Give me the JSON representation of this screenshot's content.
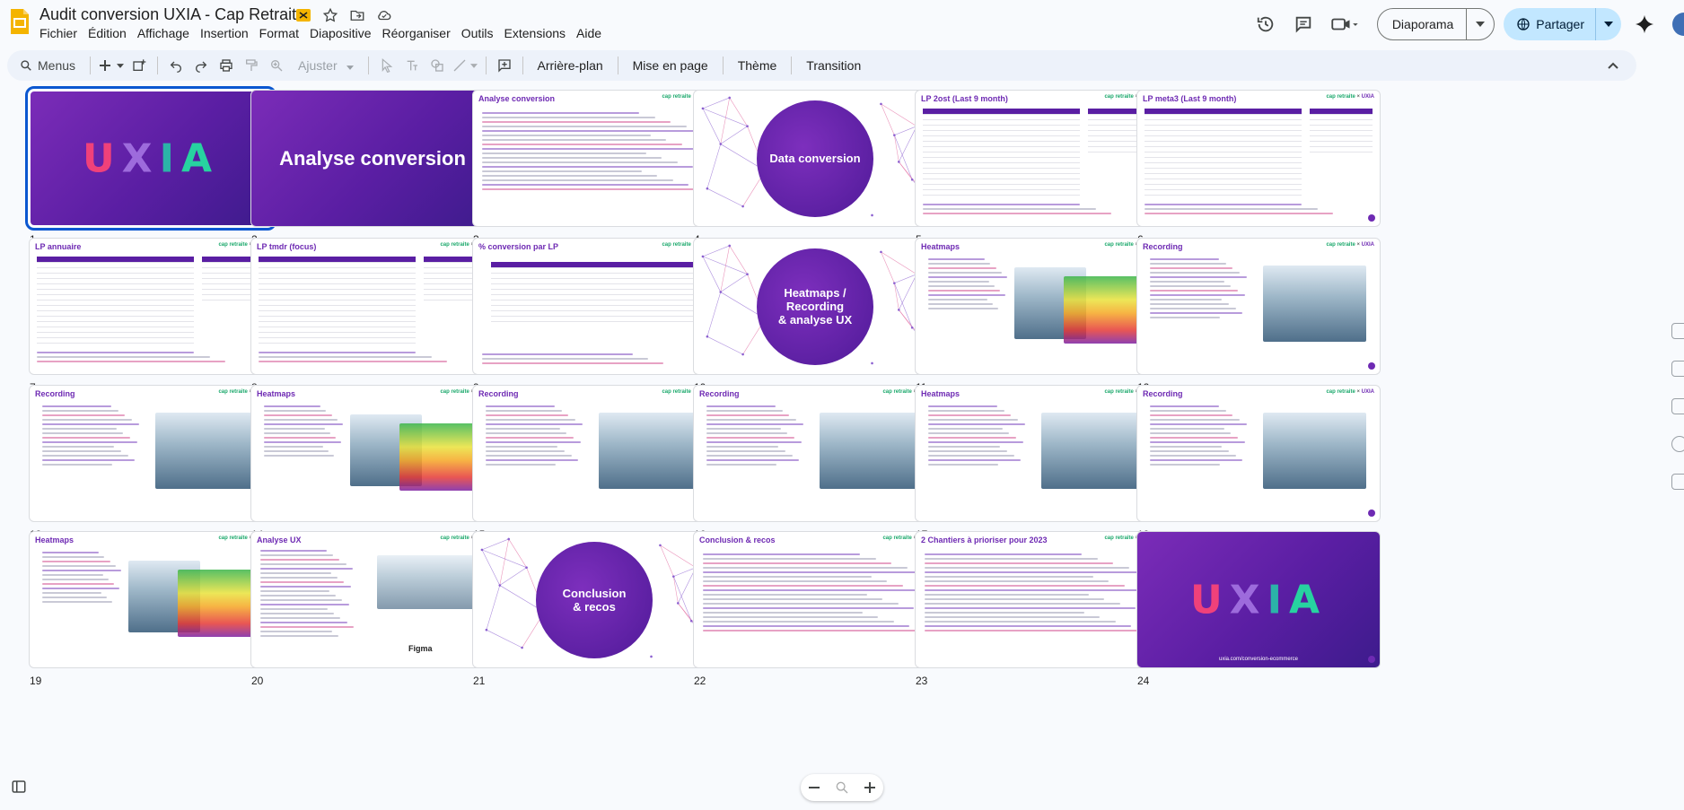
{
  "document": {
    "title": "Audit conversion UXIA - Cap Retraite"
  },
  "menu": [
    "Fichier",
    "Édition",
    "Affichage",
    "Insertion",
    "Format",
    "Diapositive",
    "Réorganiser",
    "Outils",
    "Extensions",
    "Aide"
  ],
  "header": {
    "slideshow_label": "Diaporama",
    "share_label": "Partager"
  },
  "toolbar": {
    "search_label": "Menus",
    "fit_label": "Ajuster",
    "background_label": "Arrière-plan",
    "layout_label": "Mise en page",
    "theme_label": "Thème",
    "transition_label": "Transition"
  },
  "brand": {
    "left": "cap retraite",
    "sep": "×",
    "right": "UXIA"
  },
  "colors": {
    "accent": "#0b57d0",
    "brand_purple": "#6e2ab3",
    "brand_green": "#1aa86b",
    "share_bg": "#c2e7ff"
  },
  "slides": [
    {
      "num": "1",
      "title": "UXIA",
      "kind": "logo",
      "selected": true
    },
    {
      "num": "2",
      "title": "Analyse conversion",
      "kind": "title"
    },
    {
      "num": "3",
      "title": "Analyse conversion",
      "kind": "text"
    },
    {
      "num": "4",
      "title": "Data conversion",
      "kind": "circle"
    },
    {
      "num": "5",
      "title": "LP 2ost (Last 9 month)",
      "kind": "table"
    },
    {
      "num": "6",
      "title": "LP meta3 (Last 9 month)",
      "kind": "table"
    },
    {
      "num": "7",
      "title": "LP annuaire",
      "kind": "table"
    },
    {
      "num": "8",
      "title": "LP tmdr (focus)",
      "kind": "table"
    },
    {
      "num": "9",
      "title": "% conversion par LP",
      "kind": "grid"
    },
    {
      "num": "10",
      "title": "Heatmaps /\nRecording\n& analyse UX",
      "kind": "circle"
    },
    {
      "num": "11",
      "title": "Heatmaps",
      "kind": "heat"
    },
    {
      "num": "12",
      "title": "Recording",
      "kind": "screen"
    },
    {
      "num": "13",
      "title": "Recording",
      "kind": "screen"
    },
    {
      "num": "14",
      "title": "Heatmaps",
      "kind": "heat"
    },
    {
      "num": "15",
      "title": "Recording",
      "kind": "screen"
    },
    {
      "num": "16",
      "title": "Recording",
      "kind": "screen"
    },
    {
      "num": "17",
      "title": "Heatmaps",
      "kind": "screen"
    },
    {
      "num": "18",
      "title": "Recording",
      "kind": "screen"
    },
    {
      "num": "19",
      "title": "Heatmaps",
      "kind": "heat"
    },
    {
      "num": "20",
      "title": "Analyse UX",
      "kind": "figma",
      "extra": "Figma"
    },
    {
      "num": "21",
      "title": "Conclusion\n& recos",
      "kind": "circle"
    },
    {
      "num": "22",
      "title": "Conclusion & recos",
      "kind": "text"
    },
    {
      "num": "23",
      "title": "2 Chantiers à prioriser pour 2023",
      "kind": "text"
    },
    {
      "num": "24",
      "title": "UXIA",
      "kind": "logo",
      "extra": "uxia.com/conversion-ecommerce"
    }
  ]
}
